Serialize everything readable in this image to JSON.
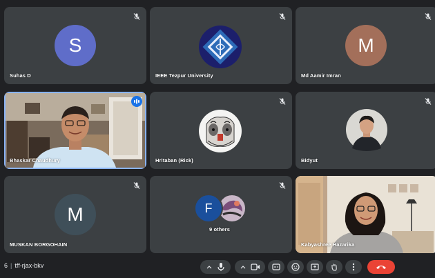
{
  "meeting": {
    "code_prefix": "6",
    "code": "tff-rjax-bkv"
  },
  "colors": {
    "background": "#202124",
    "tile": "#3c4043",
    "active_border": "#8ab4f8",
    "end_call": "#ea4335",
    "avatar_s": "#5f6dc9",
    "avatar_m1": "#a36f5a",
    "avatar_m2": "#3f4f59"
  },
  "tiles": [
    {
      "name": "Suhas D",
      "avatar_letter": "S",
      "muted": true
    },
    {
      "name": "IEEE Tezpur University",
      "avatar": "ieee-logo",
      "muted": true
    },
    {
      "name": "Md Aamir Imran",
      "avatar_letter": "M",
      "muted": true
    },
    {
      "name": "Bhaskar Chaudhury",
      "video": true,
      "speaking": true
    },
    {
      "name": "Hritaban (Rick)",
      "avatar": "sketch-photo",
      "muted": true
    },
    {
      "name": "Bidyut",
      "avatar": "profile-photo",
      "muted": true
    },
    {
      "name": "MUSKAN BORGOHAIN",
      "avatar_letter": "M",
      "muted": true
    },
    {
      "name": "9 others",
      "group_letter": "F",
      "muted": true
    },
    {
      "name": "Kabyashree Hazarika",
      "video": true
    }
  ],
  "controls": [
    "mic",
    "mic-options",
    "camera",
    "captions",
    "emoji",
    "present",
    "raise-hand",
    "more",
    "end-call"
  ]
}
